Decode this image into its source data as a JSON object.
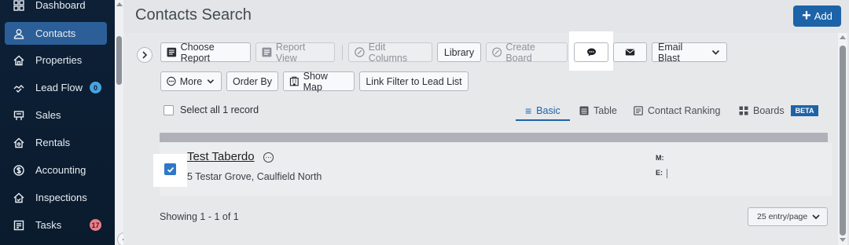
{
  "sidebar": {
    "items": [
      {
        "label": "Dashboard",
        "icon": "dashboard-icon"
      },
      {
        "label": "Contacts",
        "icon": "person-icon"
      },
      {
        "label": "Properties",
        "icon": "home-icon"
      },
      {
        "label": "Lead Flow",
        "icon": "handshake-icon",
        "badge": "0"
      },
      {
        "label": "Sales",
        "icon": "sign-icon"
      },
      {
        "label": "Rentals",
        "icon": "key-house-icon"
      },
      {
        "label": "Accounting",
        "icon": "dollar-icon"
      },
      {
        "label": "Inspections",
        "icon": "inspection-house-icon"
      },
      {
        "label": "Tasks",
        "icon": "tasks-icon",
        "badge": "17"
      }
    ]
  },
  "header": {
    "title": "Contacts Search",
    "add_label": "Add"
  },
  "toolbar": {
    "choose_report": "Choose Report",
    "report_view": "Report View",
    "edit_columns": "Edit Columns",
    "library": "Library",
    "create_board": "Create Board",
    "email_blast": "Email Blast",
    "more": "More",
    "order_by": "Order By",
    "show_map": "Show Map",
    "link_filter": "Link Filter to Lead List"
  },
  "selection": {
    "select_all": "Select all 1 record"
  },
  "views": {
    "basic": "Basic",
    "table": "Table",
    "contact_ranking": "Contact Ranking",
    "boards": "Boards",
    "beta": "BETA"
  },
  "records": [
    {
      "name": "Test Taberdo",
      "address": "5 Testar Grove, Caulfield North",
      "mobile_label": "M:",
      "email_label": "E:",
      "checked": true
    }
  ],
  "footer": {
    "showing": "Showing 1 - 1 of 1",
    "per_page": "25 entry/page"
  },
  "colors": {
    "accent": "#1d63a8",
    "sidebar_bg": "#0d2036",
    "active_item": "#2c5f98"
  }
}
